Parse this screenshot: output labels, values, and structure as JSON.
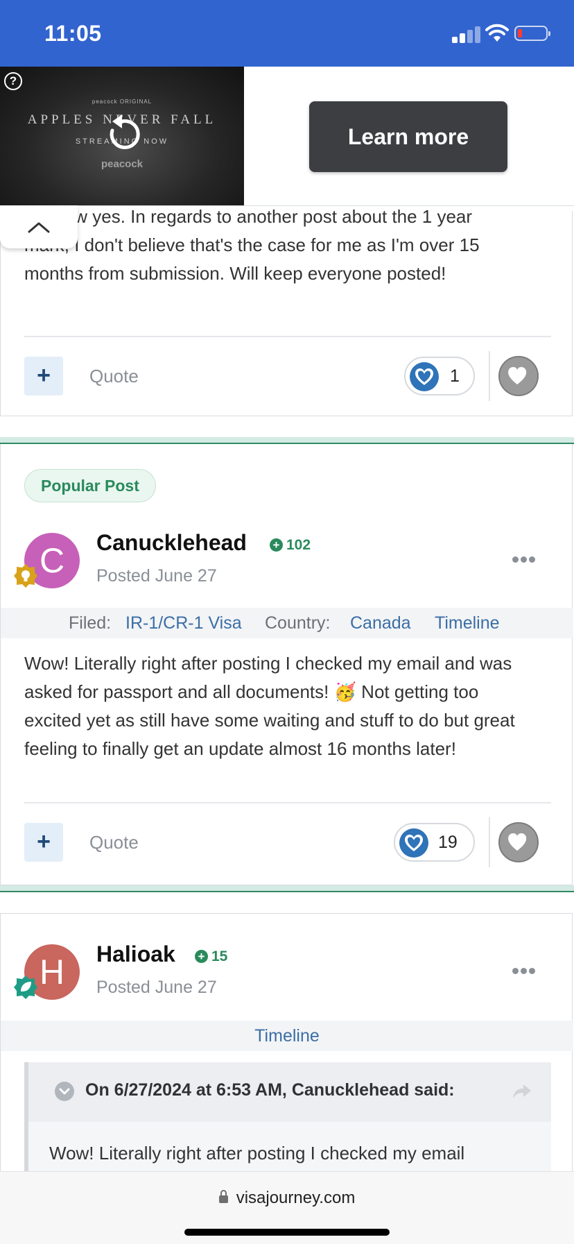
{
  "status_bar": {
    "time": "11:05"
  },
  "ad": {
    "help_glyph": "?",
    "brand_small": "peacock ORIGINAL",
    "title": "APPLES NEVER FALL",
    "stream_text": "STREAMING NOW",
    "brand": "peacock",
    "cta_label": "Learn more"
  },
  "post1": {
    "body_lines": [
      "... a few yes. In regards to another post about the 1 year",
      "mark, I don't believe that's the case for me as I'm over 15",
      "months from submission. Will keep everyone posted!"
    ],
    "quote_label": "Quote",
    "plus_glyph": "+",
    "reaction_count": "1"
  },
  "post2": {
    "badge": "Popular Post",
    "avatar_letter": "C",
    "avatar_color": "#c660b8",
    "author": "Canucklehead",
    "reputation": "102",
    "posted": "Posted June 27",
    "meta": {
      "filed_label": "Filed:",
      "filed_value": "IR-1/CR-1 Visa",
      "country_label": "Country:",
      "country_value": "Canada",
      "timeline_link": "Timeline"
    },
    "body_lines": [
      "Wow! Literally right after posting I checked my email and was",
      "asked for passport and all documents! 🥳 Not getting too",
      "excited yet as still have some waiting and stuff to do but great",
      "feeling to finally get an update almost 16 months later!"
    ],
    "quote_label": "Quote",
    "plus_glyph": "+",
    "reaction_count": "19"
  },
  "post3": {
    "avatar_letter": "H",
    "avatar_color": "#c9665d",
    "author": "Halioak",
    "reputation": "15",
    "posted": "Posted June 27",
    "timeline_link": "Timeline",
    "quote_title": "On 6/27/2024 at 6:53 AM, Canucklehead said:",
    "quote_text": "Wow! Literally right after posting I checked my email"
  },
  "browser": {
    "url": "visajourney.com"
  },
  "colors": {
    "accent_blue": "#3264cf",
    "rep_green": "#2a8a5c",
    "link_blue": "#3a6ea5"
  },
  "icons": [
    "signal-icon",
    "wifi-icon",
    "battery-icon",
    "replay-icon",
    "chevron-up-icon",
    "heart-icon",
    "more-icon",
    "badge-icon",
    "share-arrow-icon",
    "lock-icon"
  ]
}
